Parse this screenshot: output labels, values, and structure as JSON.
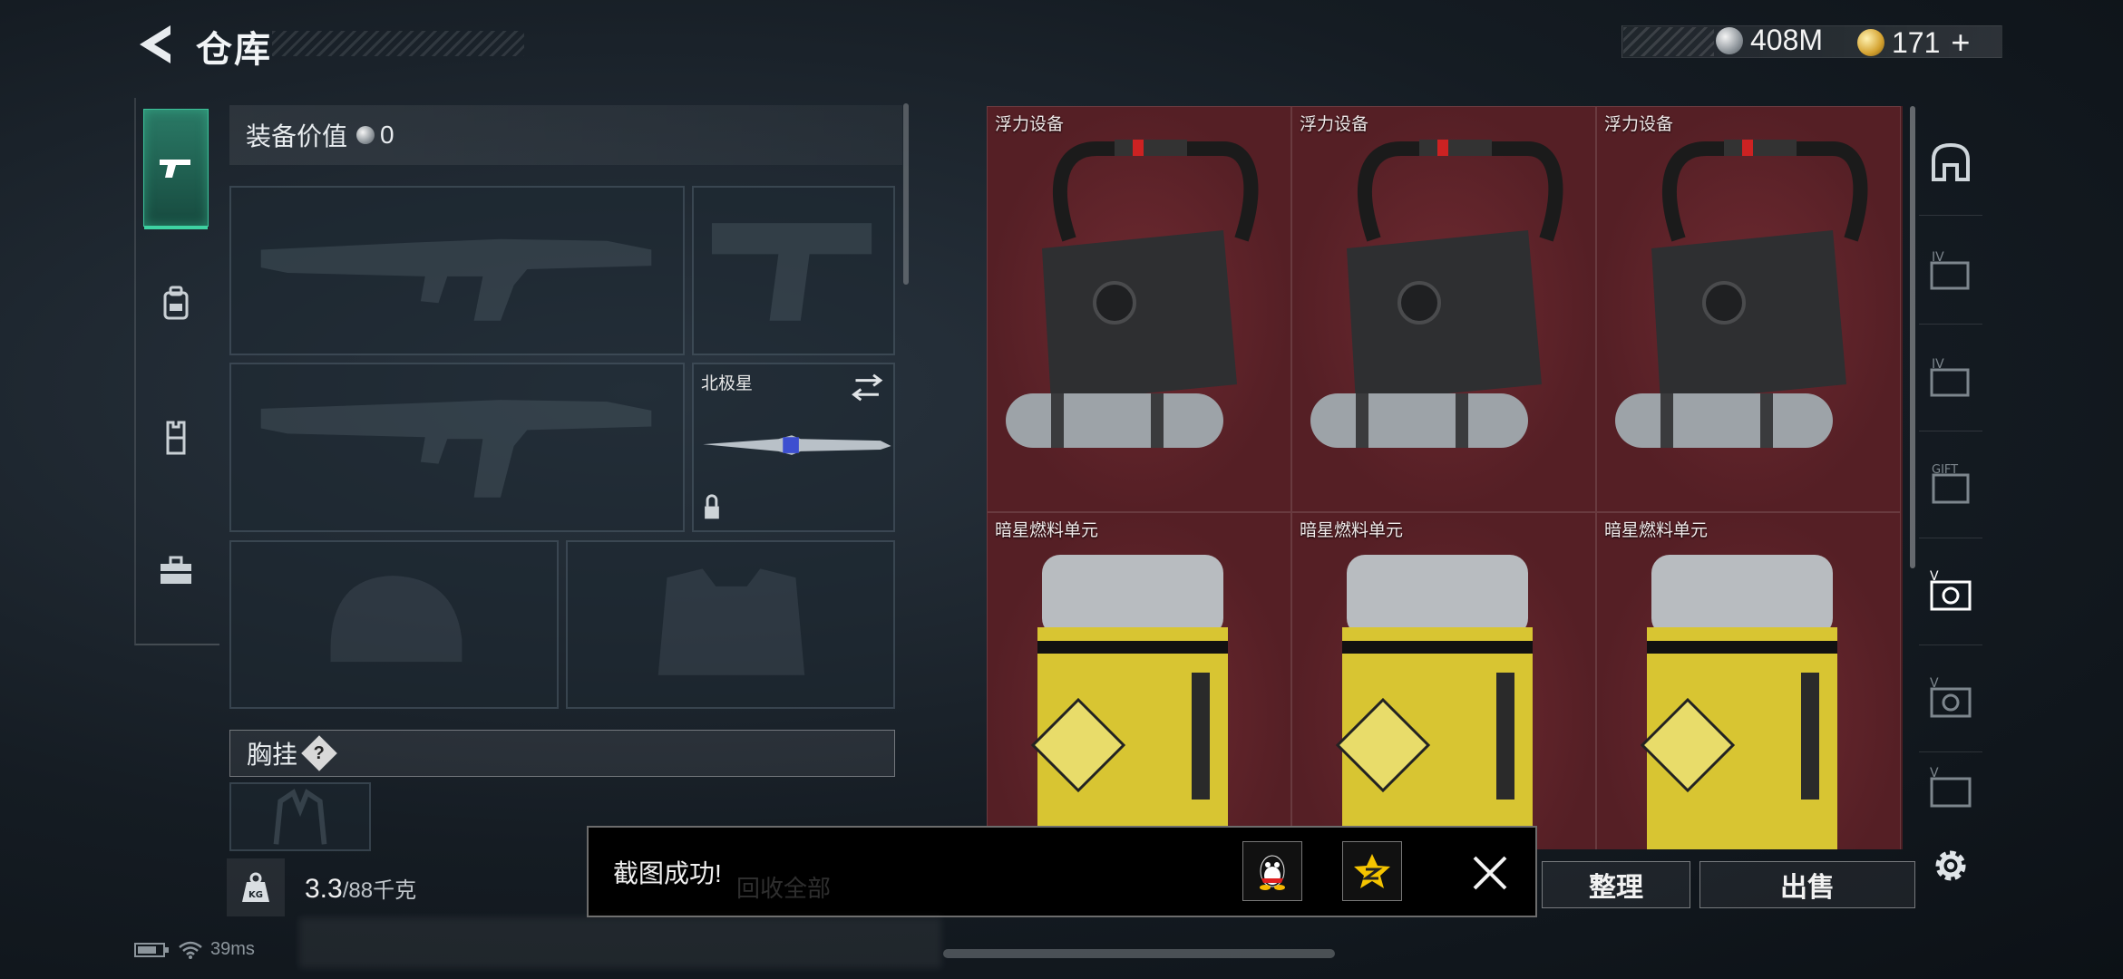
{
  "header": {
    "title": "仓库",
    "currency_silver": "408M",
    "currency_gold": "171",
    "plus_label": "+"
  },
  "categories": [
    {
      "icon": "pistol-icon",
      "active": true
    },
    {
      "icon": "backpack-icon",
      "active": false
    },
    {
      "icon": "vest-icon",
      "active": false
    },
    {
      "icon": "toolbox-icon",
      "active": false
    }
  ],
  "equipment": {
    "value_label": "装备价值",
    "value": "0",
    "melee_name": "北极星",
    "chest_rig_label": "胸挂",
    "help_label": "?"
  },
  "weight": {
    "current": "3.3",
    "max": "/88千克"
  },
  "inventory": {
    "items": [
      {
        "name": "浮力设备",
        "type": "buoyancy"
      },
      {
        "name": "浮力设备",
        "type": "buoyancy"
      },
      {
        "name": "浮力设备",
        "type": "buoyancy"
      },
      {
        "name": "暗星燃料单元",
        "type": "fuel"
      },
      {
        "name": "暗星燃料单元",
        "type": "fuel"
      },
      {
        "name": "暗星燃料单元",
        "type": "fuel"
      }
    ]
  },
  "right_tabs": [
    "helmet-slot-icon",
    "tier-iv-case-icon",
    "tier-iv-case-icon",
    "gift-case-icon",
    "tier-v-case-icon",
    "tier-v-case-icon",
    "tier-v-case-icon"
  ],
  "buttons": {
    "sort": "整理",
    "sell": "出售"
  },
  "toast": {
    "message": "截图成功!",
    "ghost_text": "回收全部"
  },
  "status": {
    "ping": "39ms"
  },
  "colors": {
    "accent": "#3cc39a",
    "grid_bg": "#5a2128",
    "gold": "#d4a230"
  }
}
